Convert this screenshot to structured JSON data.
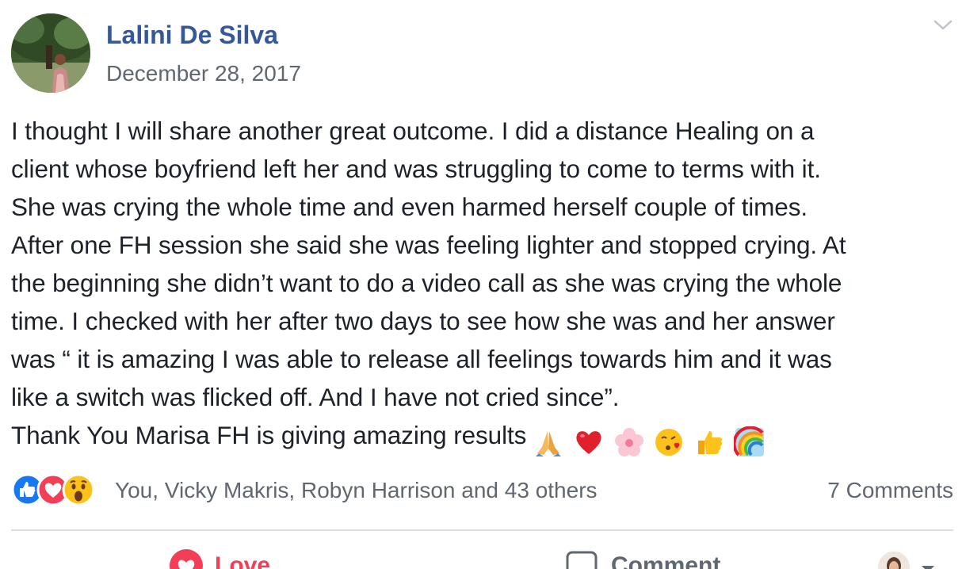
{
  "post": {
    "author": "Lalini De Silva",
    "date": "December 28, 2017",
    "body_lines": [
      "I thought I will share another great outcome. I did a distance Healing on a",
      "client whose boyfriend left her and was struggling to come to terms with it.",
      "She was crying the whole time and even harmed herself couple of times.",
      "After one FH session she said she was feeling lighter and stopped crying. At",
      "the beginning she didn’t want to do a video call as she was crying the whole",
      "time. I checked with her after two days to see how she was and her answer",
      "was “ it is amazing I was able to release all feelings towards him and it was",
      "like a switch was flicked off. And I have not cried since”.",
      "Thank You Marisa FH is giving amazing results"
    ],
    "emoji_icons": [
      "folded-hands-icon",
      "red-heart-icon",
      "cherry-blossom-icon",
      "face-blowing-kiss-icon",
      "thumbs-up-icon",
      "rainbow-icon"
    ]
  },
  "reactions": {
    "icons": [
      "like-icon",
      "love-icon",
      "wow-icon"
    ],
    "names": "You, Vicky Makris, Robyn Harrison and 43 others",
    "comments": "7 Comments"
  },
  "actions": {
    "love_label": "Love",
    "comment_label": "Comment"
  },
  "colors": {
    "author_link": "#365899",
    "secondary_text": "#616770",
    "love_red": "#f33e58",
    "like_blue": "#1877f2",
    "divider": "#dadde1"
  }
}
